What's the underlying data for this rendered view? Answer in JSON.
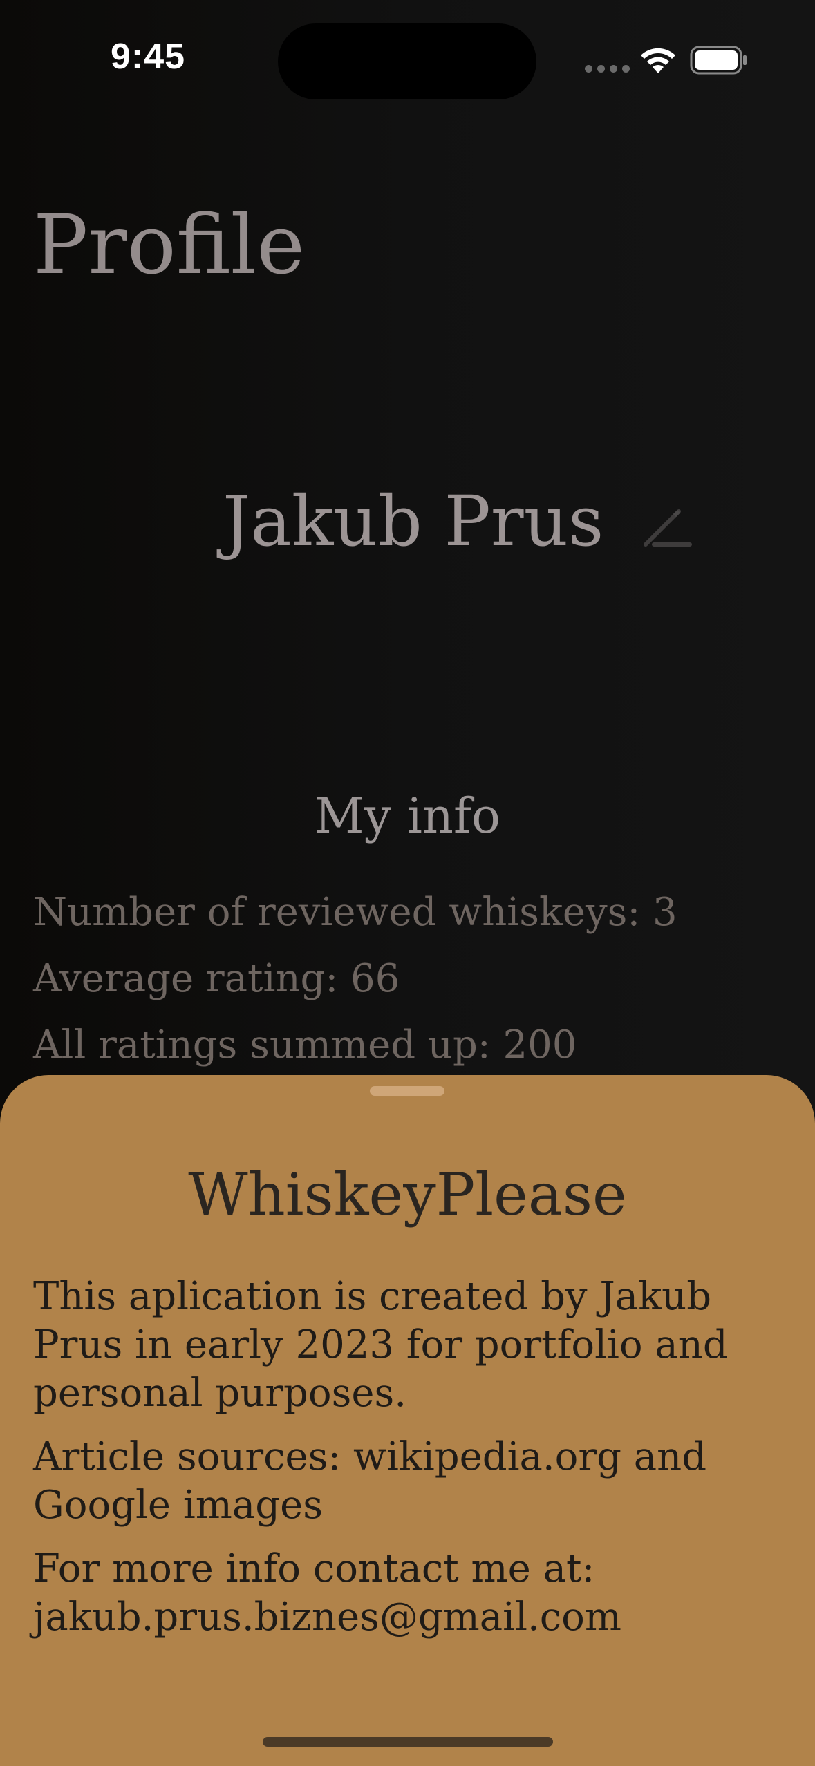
{
  "status_bar": {
    "time": "9:45"
  },
  "profile": {
    "title": "Profile",
    "name": "Jakub Prus"
  },
  "my_info": {
    "heading": "My info",
    "stats": [
      "Number of reviewed whiskeys: 3",
      "Average rating: 66",
      "All ratings summed up: 200"
    ]
  },
  "sheet": {
    "title": "WhiskeyPlease",
    "paragraphs": [
      "This aplication is created by Jakub Prus in early 2023 for portfolio and personal purposes.",
      "Article sources: wikipedia.org and Google images",
      "For more info contact me at: jakub.prus.biznes@gmail.com"
    ]
  },
  "colors": {
    "sheet_background": "#b1834a",
    "page_background": "#111111",
    "title_text": "#948c8c",
    "stat_text": "#6e6560"
  },
  "icons": {
    "edit": "pencil-icon",
    "wifi": "wifi-icon",
    "battery": "battery-icon",
    "signal": "cellular-signal-icon"
  }
}
